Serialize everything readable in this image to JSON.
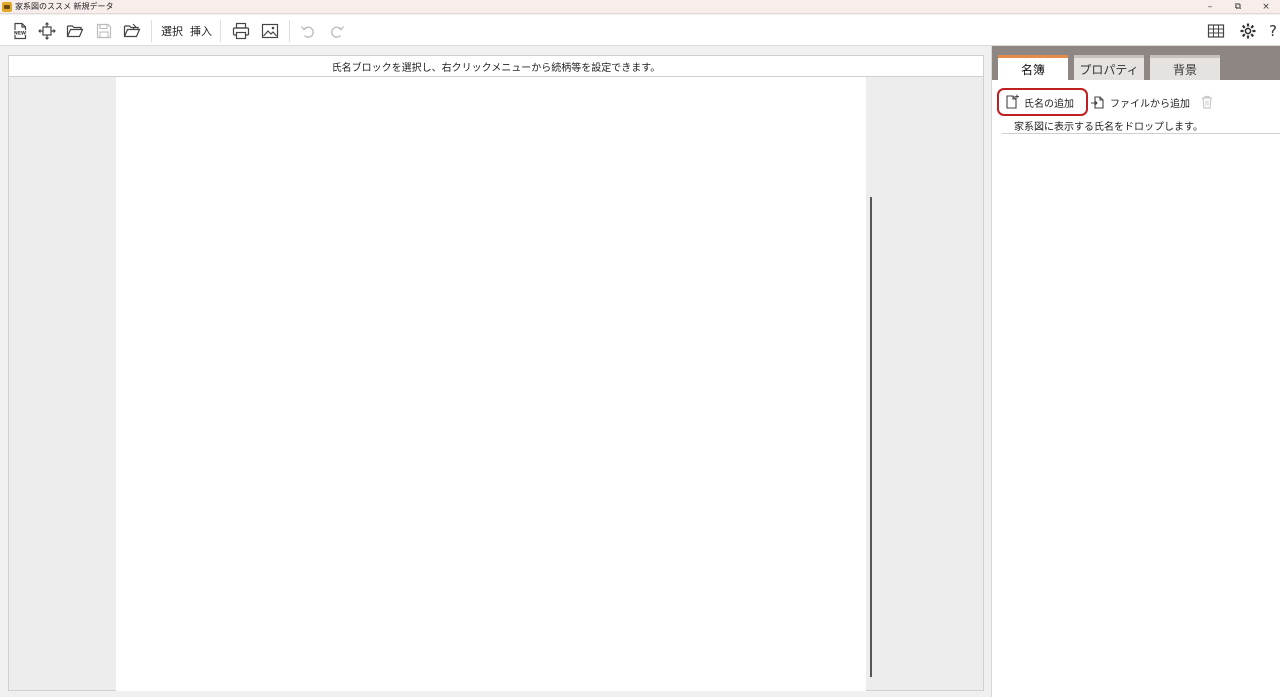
{
  "window": {
    "title": "家系図のススメ 新規データ",
    "minimize_glyph": "–",
    "restore_glyph": "⧉",
    "close_glyph": "×"
  },
  "toolbar": {
    "select_label": "選択",
    "insert_label": "挿入"
  },
  "canvas": {
    "hint": "氏名ブロックを選択し、右クリックメニューから続柄等を設定できます。"
  },
  "panel": {
    "tabs": [
      "名簿",
      "プロパティ",
      "背景"
    ],
    "active_tab": "名簿",
    "add_name_label": "氏名の追加",
    "add_from_file_label": "ファイルから追加",
    "drop_hint": "家系図に表示する氏名をドロップします。"
  },
  "colors": {
    "accent_tab": "#e38b4a",
    "highlight_border": "#c01f1f",
    "tabstrip_bg": "#8e8683"
  }
}
